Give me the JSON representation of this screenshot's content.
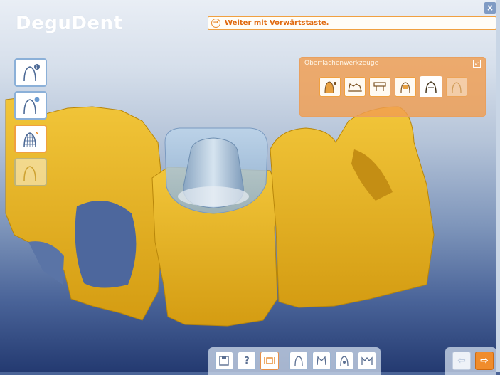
{
  "app": {
    "brand": "DeguDent",
    "close_label": "×"
  },
  "hint": {
    "text": "Weiter mit Vorwärtstaste."
  },
  "left_tools": [
    {
      "name": "tooth-info-icon"
    },
    {
      "name": "tooth-settings-icon"
    },
    {
      "name": "tooth-mesh-icon",
      "active": true
    },
    {
      "name": "tooth-shape-icon",
      "disabled": true
    }
  ],
  "surface_panel": {
    "title": "Oberflächenwerkzeuge",
    "tools": [
      {
        "name": "material-add-icon"
      },
      {
        "name": "smooth-icon"
      },
      {
        "name": "cut-icon"
      },
      {
        "name": "adapt-icon"
      },
      {
        "name": "shape-icon",
        "selected": true
      },
      {
        "name": "morph-icon",
        "disabled": true
      }
    ]
  },
  "bottom_toolbar": {
    "save_label": "💾",
    "help_label": "?",
    "view_label": "[○]"
  },
  "colors": {
    "accent": "#f08c2c",
    "tooth": "#e6b020",
    "cap": "#a9c4dd"
  }
}
